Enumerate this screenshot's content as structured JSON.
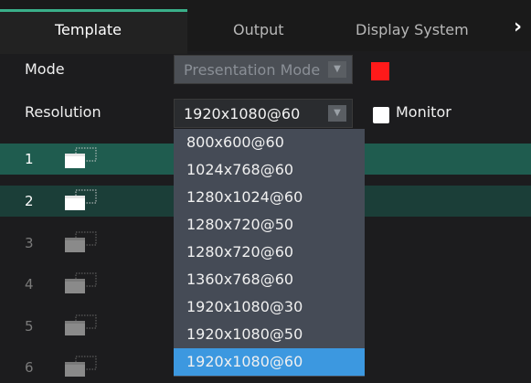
{
  "tabs": {
    "prev_icon": "chevron-left-icon",
    "active": "Template",
    "output": "Output",
    "display": "Display System",
    "next_icon": "chevron-right-icon"
  },
  "mode": {
    "label": "Mode",
    "value": "Presentation Mode",
    "swatch_color": "#ff1a1a"
  },
  "resolution": {
    "label": "Resolution",
    "value": "1920x1080@60",
    "options": [
      "800x600@60",
      "1024x768@60",
      "1280x1024@60",
      "1280x720@50",
      "1280x720@60",
      "1360x768@60",
      "1920x1080@30",
      "1920x1080@50",
      "1920x1080@60"
    ],
    "selected_index": 8
  },
  "monitor": {
    "label": "Monitor",
    "checked": false
  },
  "layers": [
    {
      "num": "1",
      "active": true
    },
    {
      "num": "2",
      "active": true
    },
    {
      "num": "3",
      "active": false
    },
    {
      "num": "4",
      "active": false
    },
    {
      "num": "5",
      "active": false
    },
    {
      "num": "6",
      "active": false
    }
  ],
  "colors": {
    "accent": "#3ab08a",
    "selected_row": "#1f5c4f",
    "dropdown_highlight": "#3c98e0"
  }
}
